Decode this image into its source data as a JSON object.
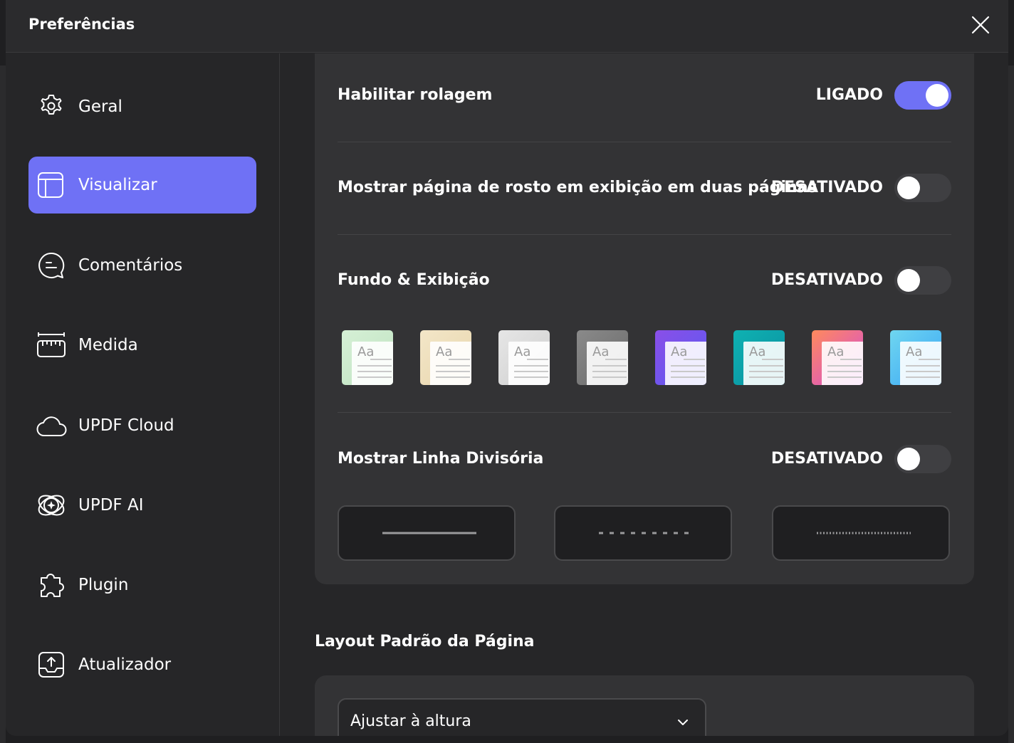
{
  "dialog": {
    "title": "Preferências"
  },
  "sidebar": {
    "items": [
      {
        "label": "Geral",
        "icon": "gear-icon",
        "active": false
      },
      {
        "label": "Visualizar",
        "icon": "layout-icon",
        "active": true
      },
      {
        "label": "Comentários",
        "icon": "comment-icon",
        "active": false
      },
      {
        "label": "Medida",
        "icon": "ruler-icon",
        "active": false
      },
      {
        "label": "UPDF Cloud",
        "icon": "cloud-icon",
        "active": false
      },
      {
        "label": "UPDF AI",
        "icon": "ai-sparkle-icon",
        "active": false
      },
      {
        "label": "Plugin",
        "icon": "puzzle-icon",
        "active": false
      },
      {
        "label": "Atualizador",
        "icon": "update-icon",
        "active": false
      }
    ]
  },
  "settings": {
    "scroll": {
      "label": "Habilitar rolagem",
      "state": "LIGADO",
      "on": true
    },
    "cover": {
      "label": "Mostrar página de rosto em exibição em duas páginas",
      "state": "DESATIVADO",
      "on": false
    },
    "background": {
      "label": "Fundo & Exibição",
      "state": "DESATIVADO",
      "on": false,
      "theme_sample_text": "Aa"
    },
    "divider": {
      "label": "Mostrar Linha Divisória",
      "state": "DESATIVADO",
      "on": false
    }
  },
  "themes": [
    {
      "name": "green",
      "colors": [
        "#d6f0d6",
        "#bfe3c1"
      ]
    },
    {
      "name": "beige",
      "colors": [
        "#f3e6c8",
        "#e8d6ad"
      ]
    },
    {
      "name": "light-gray",
      "colors": [
        "#e6e6e6",
        "#cfcfcf"
      ]
    },
    {
      "name": "dark-gray",
      "colors": [
        "#8a8a8a",
        "#6a6a6a"
      ]
    },
    {
      "name": "purple",
      "colors": [
        "#8a4fe8",
        "#5a5af0"
      ]
    },
    {
      "name": "teal",
      "colors": [
        "#0fb2b2",
        "#0a8fa0"
      ]
    },
    {
      "name": "sunset",
      "colors": [
        "#ff8a5c",
        "#d44bd8"
      ]
    },
    {
      "name": "sky",
      "colors": [
        "#6fd6f0",
        "#3aa5f5"
      ]
    }
  ],
  "line_styles": [
    "solid",
    "dashed",
    "dotted"
  ],
  "layout": {
    "title": "Layout Padrão da Página",
    "selected": "Ajustar à altura"
  },
  "colors": {
    "accent": "#6f71f5"
  }
}
